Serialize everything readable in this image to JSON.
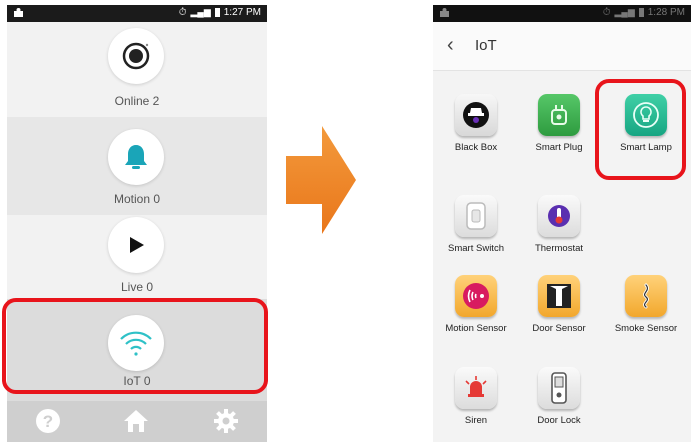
{
  "left_screen": {
    "status_time": "1:27 PM",
    "items": [
      {
        "label": "Online 2",
        "icon": "record-icon"
      },
      {
        "label": "Motion 0",
        "icon": "bell-icon"
      },
      {
        "label": "Live 0",
        "icon": "play-icon"
      },
      {
        "label": "IoT 0",
        "icon": "wifi-icon"
      }
    ],
    "bottom_icons": [
      "help-icon",
      "home-icon",
      "settings-icon"
    ]
  },
  "right_screen": {
    "status_time": "1:28 PM",
    "title": "IoT",
    "devices": [
      {
        "label": "Black Box",
        "icon": "black-box-icon"
      },
      {
        "label": "Smart Plug",
        "icon": "smart-plug-icon"
      },
      {
        "label": "Smart Lamp",
        "icon": "smart-lamp-icon"
      },
      {
        "label": "Smart Switch",
        "icon": "smart-switch-icon"
      },
      {
        "label": "Thermostat",
        "icon": "thermostat-icon"
      },
      {
        "label": "Motion Sensor",
        "icon": "motion-sensor-icon"
      },
      {
        "label": "Door Sensor",
        "icon": "door-sensor-icon"
      },
      {
        "label": "Smoke Sensor",
        "icon": "smoke-sensor-icon"
      },
      {
        "label": "Siren",
        "icon": "siren-icon"
      },
      {
        "label": "Door Lock",
        "icon": "door-lock-icon"
      }
    ]
  },
  "colors": {
    "highlight": "#e8141b",
    "arrow": "#f08a2a",
    "accent": "#1aa5b8"
  }
}
